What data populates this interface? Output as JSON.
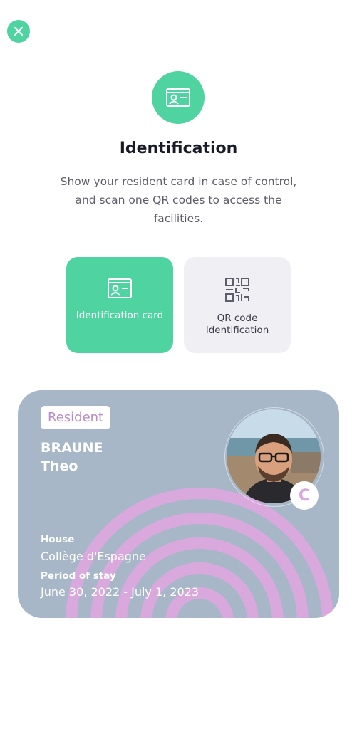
{
  "header": {
    "close_icon": "close-icon",
    "title": "Identification",
    "subtitle": "Show your resident card in case of control, and scan one QR codes to access the facilities.",
    "hero_icon": "id-card-icon"
  },
  "options": [
    {
      "label": "Identification card",
      "icon": "id-card-icon",
      "active": true
    },
    {
      "label": "QR code Identification",
      "icon": "qr-code-icon",
      "active": false
    }
  ],
  "card": {
    "badge": "Resident",
    "last_name": "BRAUNE",
    "first_name": "Theo",
    "house_label": "House",
    "house_value": "Collège d'Espagne",
    "period_label": "Period of stay",
    "period_value": "June 30, 2022 - July 1, 2023",
    "logo_letter": "C"
  },
  "colors": {
    "accent": "#4fd3a1",
    "card_bg": "#a7b7c8",
    "arc": "#d9a9de",
    "inactive_bg": "#f0f0f4"
  }
}
